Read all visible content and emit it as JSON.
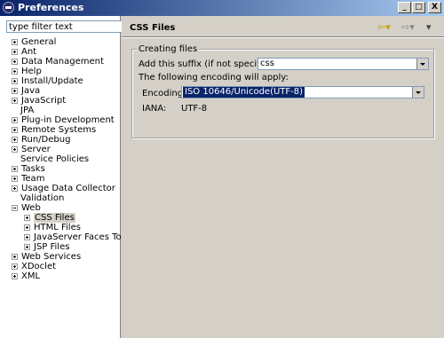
{
  "window": {
    "title": "Preferences",
    "min_label": "_",
    "max_label": "□",
    "close_label": "X"
  },
  "filter": {
    "placeholder": "type filter text",
    "value": "type filter text"
  },
  "tree": {
    "items": [
      {
        "label": "General",
        "expander": "plus"
      },
      {
        "label": "Ant",
        "expander": "plus"
      },
      {
        "label": "Data Management",
        "expander": "plus"
      },
      {
        "label": "Help",
        "expander": "plus"
      },
      {
        "label": "Install/Update",
        "expander": "plus"
      },
      {
        "label": "Java",
        "expander": "plus"
      },
      {
        "label": "JavaScript",
        "expander": "plus"
      },
      {
        "label": "JPA",
        "expander": "none"
      },
      {
        "label": "Plug-in Development",
        "expander": "plus"
      },
      {
        "label": "Remote Systems",
        "expander": "plus"
      },
      {
        "label": "Run/Debug",
        "expander": "plus"
      },
      {
        "label": "Server",
        "expander": "plus"
      },
      {
        "label": "Service Policies",
        "expander": "none"
      },
      {
        "label": "Tasks",
        "expander": "plus"
      },
      {
        "label": "Team",
        "expander": "plus"
      },
      {
        "label": "Usage Data Collector",
        "expander": "plus"
      },
      {
        "label": "Validation",
        "expander": "none"
      },
      {
        "label": "Web",
        "expander": "minus"
      },
      {
        "label": "CSS Files",
        "expander": "plus",
        "child": true,
        "selected": true
      },
      {
        "label": "HTML Files",
        "expander": "plus",
        "child": true
      },
      {
        "label": "JavaServer Faces Tool",
        "expander": "plus",
        "child": true
      },
      {
        "label": "JSP Files",
        "expander": "plus",
        "child": true
      },
      {
        "label": "Web Services",
        "expander": "plus"
      },
      {
        "label": "XDoclet",
        "expander": "plus"
      },
      {
        "label": "XML",
        "expander": "plus"
      }
    ]
  },
  "page": {
    "title": "CSS Files",
    "back_icon": "back-arrow-icon",
    "forward_icon": "forward-arrow-icon",
    "menu_icon": "view-menu-icon"
  },
  "group": {
    "label": "Creating files",
    "suffix_label": "Add this suffix (if not specified):",
    "suffix_value": "css",
    "encoding_note": "The following encoding will apply:",
    "encoding_label": "Encoding:",
    "encoding_value": "ISO 10646/Unicode(UTF-8)",
    "iana_label": "IANA:",
    "iana_value": "UTF-8"
  }
}
